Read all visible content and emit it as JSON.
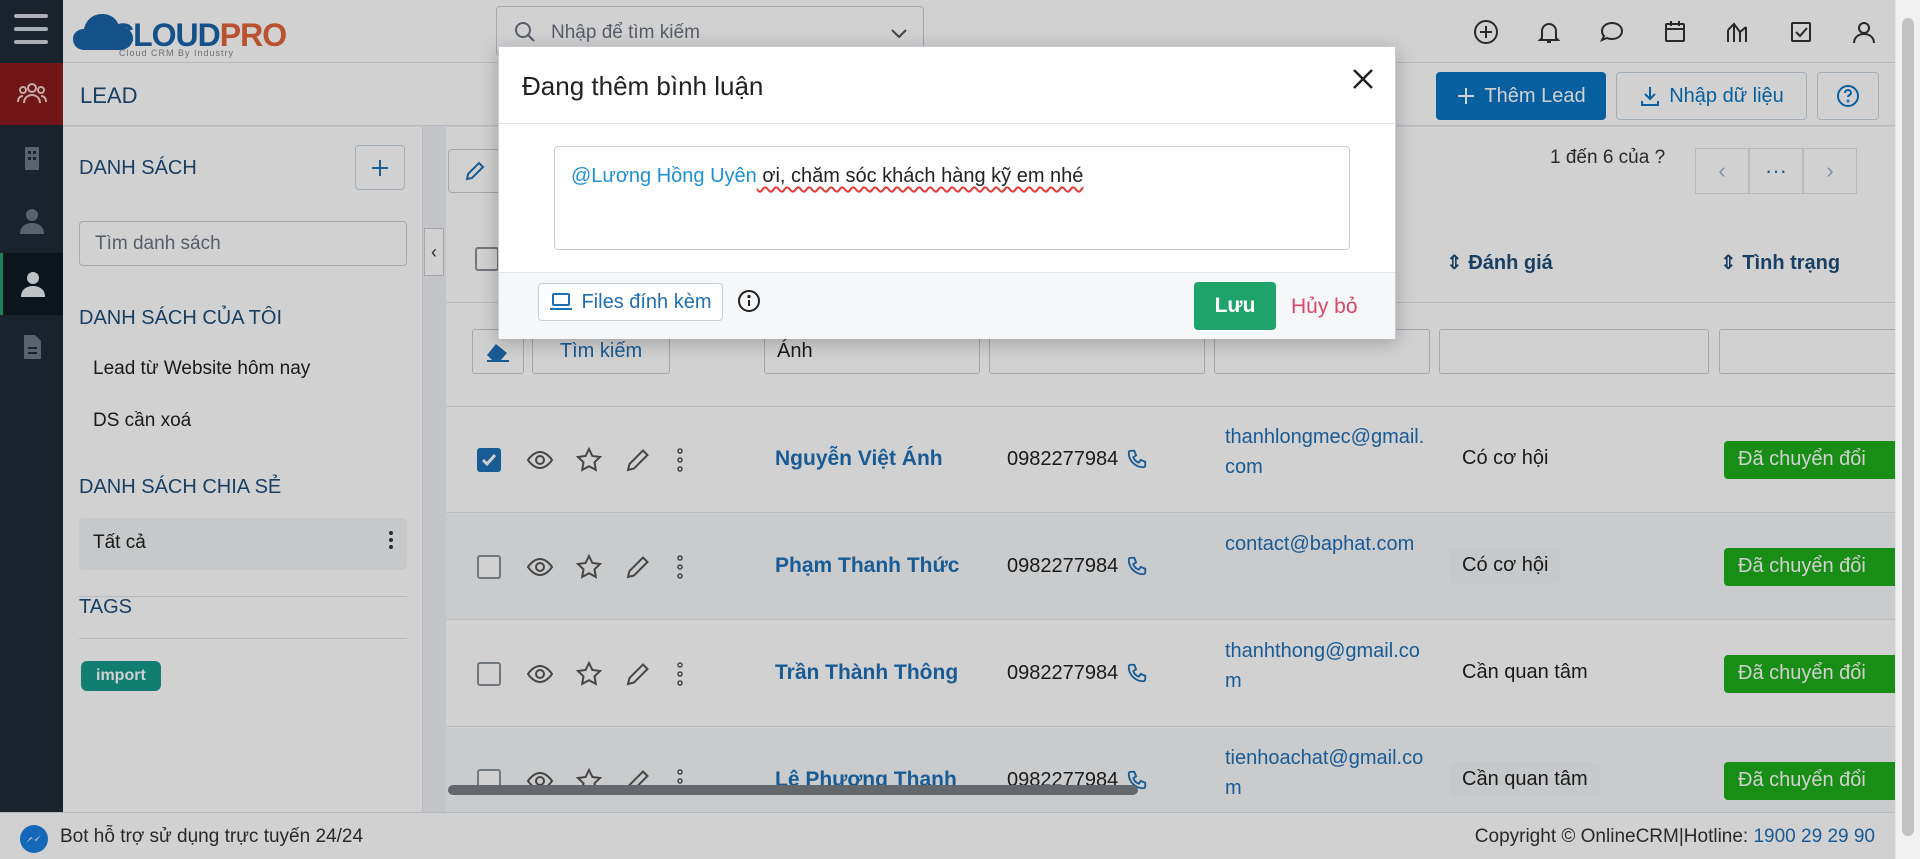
{
  "app": {
    "logo_text_main": "CLOUD",
    "logo_text_accent": "PRO",
    "logo_tagline": "Cloud CRM By Industry"
  },
  "search": {
    "placeholder": "Nhập để tìm kiếm"
  },
  "topbar_icons": [
    "plus-circle-icon",
    "bell-icon",
    "chat-icon",
    "calendar-icon",
    "chart-icon",
    "checkbox-icon",
    "user-icon"
  ],
  "rail_icons": [
    "menu-icon",
    "leads-group-icon",
    "building-icon",
    "contact-icon",
    "person-icon",
    "document-icon"
  ],
  "subheader": {
    "title": "LEAD",
    "add_label": "Thêm Lead",
    "import_label": "Nhập dữ liệu"
  },
  "sidebar": {
    "list_title": "DANH SÁCH",
    "filter_placeholder": "Tìm danh sách",
    "my_lists_title": "DANH SÁCH CỦA TÔI",
    "my_lists": [
      "Lead từ Website hôm nay",
      "DS cần xoá"
    ],
    "shared_title": "DANH SÁCH CHIA SẺ",
    "shared_item": "Tất cả",
    "tags_title": "TAGS",
    "tag": "import"
  },
  "grid": {
    "pager_text": "1 đến 6 của",
    "pager_unknown": "?",
    "columns": {
      "rating": "Đánh giá",
      "status": "Tình trạng"
    },
    "filter": {
      "search_button": "Tìm kiếm",
      "name_value": "Ánh"
    },
    "rows": [
      {
        "checked": true,
        "name": "Nguyễn Việt Ánh",
        "phone": "0982277984",
        "email": "thanhlongmec@gmail.com",
        "rating": "Có cơ hội",
        "status": "Đã chuyển đổi"
      },
      {
        "checked": false,
        "name": "Phạm Thanh Thức",
        "phone": "0982277984",
        "email": "contact@baphat.com",
        "rating": "Có cơ hội",
        "status": "Đã chuyển đổi"
      },
      {
        "checked": false,
        "name": "Trần Thành Thông",
        "phone": "0982277984",
        "email": "thanhthong@gmail.com",
        "rating": "Cần quan tâm",
        "status": "Đã chuyển đổi"
      },
      {
        "checked": false,
        "name": "Lê Phương Thanh",
        "phone": "0982277984",
        "email": "tienhoachat@gmail.com",
        "rating": "Cần quan tâm",
        "status": "Đã chuyển đổi"
      }
    ]
  },
  "footer": {
    "bot_text": "Bot hỗ trợ sử dụng trực tuyến 24/24",
    "copyright": "Copyright © OnlineCRM|Hotline: ",
    "hotline": "1900 29 29 90"
  },
  "modal": {
    "title": "Đang thêm bình luận",
    "mention": "@Lương Hồng Uyên",
    "comment": " ơi, chăm sóc khách hàng kỹ em nhé",
    "files_label": "Files đính kèm",
    "save_label": "Lưu",
    "cancel_label": "Hủy bỏ"
  },
  "colors": {
    "primary": "#0a75c2",
    "save": "#1ea36a",
    "status_green": "#1fae1b",
    "tag_teal": "#149a8a",
    "cancel_red": "#d9476b"
  }
}
